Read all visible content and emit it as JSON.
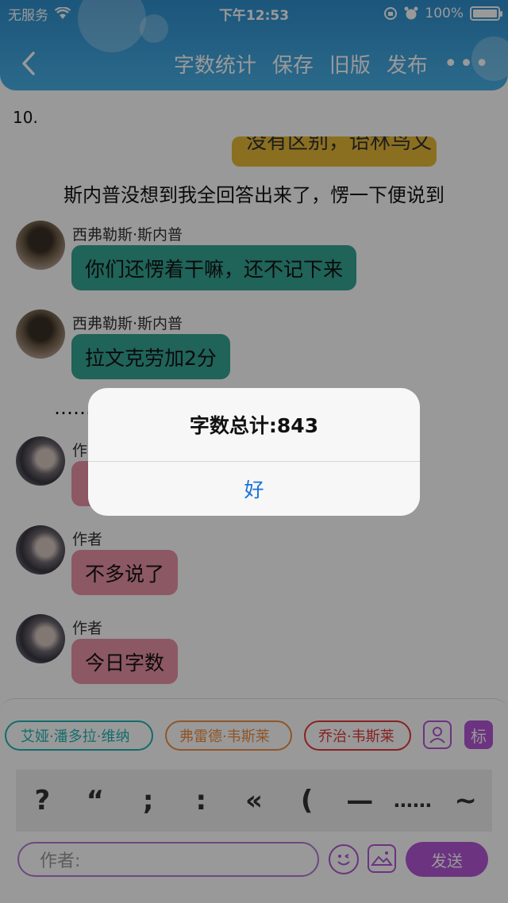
{
  "status_bar": {
    "carrier": "无服务",
    "time": "下午12:53",
    "battery": "100%"
  },
  "header": {
    "nav_items": [
      "字数统计",
      "保存",
      "旧版",
      "发布"
    ],
    "more": "•••"
  },
  "chat": {
    "line_number": "10.",
    "partial_bubble_text": "没有区别，诒林鸟文",
    "narration": "斯内普没想到我全回答出来了，愣一下便说到",
    "messages": [
      {
        "sender": "西弗勒斯·斯内普",
        "text": "你们还愣着干嘛，还不记下来"
      },
      {
        "sender": "西弗勒斯·斯内普",
        "text": "拉文克劳加2分"
      },
      {
        "sender": "作者",
        "text": "不多说了"
      },
      {
        "sender": "作者",
        "text": "今日字数"
      }
    ],
    "ellipsis": "……"
  },
  "bottom": {
    "chips": [
      "艾娅·潘多拉·维纳",
      "弗雷德·韦斯莱",
      "乔治·韦斯莱"
    ],
    "tag_label": "标",
    "punctuation": [
      "?",
      "“",
      ";",
      ":",
      "«",
      "(",
      "—",
      "……",
      "~"
    ],
    "input_placeholder": "作者:",
    "send_label": "发送"
  },
  "alert": {
    "title": "字数总计:843",
    "ok_label": "好"
  },
  "colors": {
    "header": "#3fa4de",
    "teal": "#35a594",
    "pink": "#ea93a5",
    "accent": "#b455d6",
    "ios_blue": "#1a73d9"
  }
}
